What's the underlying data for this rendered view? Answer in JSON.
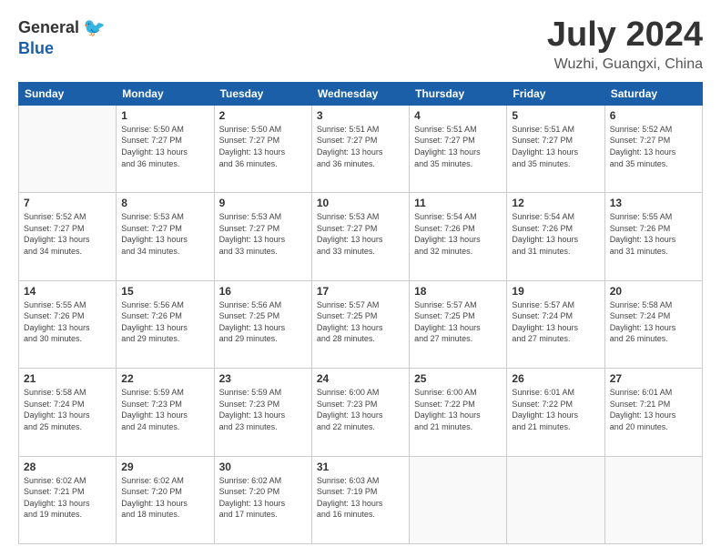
{
  "header": {
    "logo_general": "General",
    "logo_blue": "Blue",
    "month_title": "July 2024",
    "location": "Wuzhi, Guangxi, China"
  },
  "days_of_week": [
    "Sunday",
    "Monday",
    "Tuesday",
    "Wednesday",
    "Thursday",
    "Friday",
    "Saturday"
  ],
  "weeks": [
    [
      {
        "day": "",
        "info": ""
      },
      {
        "day": "1",
        "info": "Sunrise: 5:50 AM\nSunset: 7:27 PM\nDaylight: 13 hours\nand 36 minutes."
      },
      {
        "day": "2",
        "info": "Sunrise: 5:50 AM\nSunset: 7:27 PM\nDaylight: 13 hours\nand 36 minutes."
      },
      {
        "day": "3",
        "info": "Sunrise: 5:51 AM\nSunset: 7:27 PM\nDaylight: 13 hours\nand 36 minutes."
      },
      {
        "day": "4",
        "info": "Sunrise: 5:51 AM\nSunset: 7:27 PM\nDaylight: 13 hours\nand 35 minutes."
      },
      {
        "day": "5",
        "info": "Sunrise: 5:51 AM\nSunset: 7:27 PM\nDaylight: 13 hours\nand 35 minutes."
      },
      {
        "day": "6",
        "info": "Sunrise: 5:52 AM\nSunset: 7:27 PM\nDaylight: 13 hours\nand 35 minutes."
      }
    ],
    [
      {
        "day": "7",
        "info": "Sunrise: 5:52 AM\nSunset: 7:27 PM\nDaylight: 13 hours\nand 34 minutes."
      },
      {
        "day": "8",
        "info": "Sunrise: 5:53 AM\nSunset: 7:27 PM\nDaylight: 13 hours\nand 34 minutes."
      },
      {
        "day": "9",
        "info": "Sunrise: 5:53 AM\nSunset: 7:27 PM\nDaylight: 13 hours\nand 33 minutes."
      },
      {
        "day": "10",
        "info": "Sunrise: 5:53 AM\nSunset: 7:27 PM\nDaylight: 13 hours\nand 33 minutes."
      },
      {
        "day": "11",
        "info": "Sunrise: 5:54 AM\nSunset: 7:26 PM\nDaylight: 13 hours\nand 32 minutes."
      },
      {
        "day": "12",
        "info": "Sunrise: 5:54 AM\nSunset: 7:26 PM\nDaylight: 13 hours\nand 31 minutes."
      },
      {
        "day": "13",
        "info": "Sunrise: 5:55 AM\nSunset: 7:26 PM\nDaylight: 13 hours\nand 31 minutes."
      }
    ],
    [
      {
        "day": "14",
        "info": "Sunrise: 5:55 AM\nSunset: 7:26 PM\nDaylight: 13 hours\nand 30 minutes."
      },
      {
        "day": "15",
        "info": "Sunrise: 5:56 AM\nSunset: 7:26 PM\nDaylight: 13 hours\nand 29 minutes."
      },
      {
        "day": "16",
        "info": "Sunrise: 5:56 AM\nSunset: 7:25 PM\nDaylight: 13 hours\nand 29 minutes."
      },
      {
        "day": "17",
        "info": "Sunrise: 5:57 AM\nSunset: 7:25 PM\nDaylight: 13 hours\nand 28 minutes."
      },
      {
        "day": "18",
        "info": "Sunrise: 5:57 AM\nSunset: 7:25 PM\nDaylight: 13 hours\nand 27 minutes."
      },
      {
        "day": "19",
        "info": "Sunrise: 5:57 AM\nSunset: 7:24 PM\nDaylight: 13 hours\nand 27 minutes."
      },
      {
        "day": "20",
        "info": "Sunrise: 5:58 AM\nSunset: 7:24 PM\nDaylight: 13 hours\nand 26 minutes."
      }
    ],
    [
      {
        "day": "21",
        "info": "Sunrise: 5:58 AM\nSunset: 7:24 PM\nDaylight: 13 hours\nand 25 minutes."
      },
      {
        "day": "22",
        "info": "Sunrise: 5:59 AM\nSunset: 7:23 PM\nDaylight: 13 hours\nand 24 minutes."
      },
      {
        "day": "23",
        "info": "Sunrise: 5:59 AM\nSunset: 7:23 PM\nDaylight: 13 hours\nand 23 minutes."
      },
      {
        "day": "24",
        "info": "Sunrise: 6:00 AM\nSunset: 7:23 PM\nDaylight: 13 hours\nand 22 minutes."
      },
      {
        "day": "25",
        "info": "Sunrise: 6:00 AM\nSunset: 7:22 PM\nDaylight: 13 hours\nand 21 minutes."
      },
      {
        "day": "26",
        "info": "Sunrise: 6:01 AM\nSunset: 7:22 PM\nDaylight: 13 hours\nand 21 minutes."
      },
      {
        "day": "27",
        "info": "Sunrise: 6:01 AM\nSunset: 7:21 PM\nDaylight: 13 hours\nand 20 minutes."
      }
    ],
    [
      {
        "day": "28",
        "info": "Sunrise: 6:02 AM\nSunset: 7:21 PM\nDaylight: 13 hours\nand 19 minutes."
      },
      {
        "day": "29",
        "info": "Sunrise: 6:02 AM\nSunset: 7:20 PM\nDaylight: 13 hours\nand 18 minutes."
      },
      {
        "day": "30",
        "info": "Sunrise: 6:02 AM\nSunset: 7:20 PM\nDaylight: 13 hours\nand 17 minutes."
      },
      {
        "day": "31",
        "info": "Sunrise: 6:03 AM\nSunset: 7:19 PM\nDaylight: 13 hours\nand 16 minutes."
      },
      {
        "day": "",
        "info": ""
      },
      {
        "day": "",
        "info": ""
      },
      {
        "day": "",
        "info": ""
      }
    ]
  ]
}
